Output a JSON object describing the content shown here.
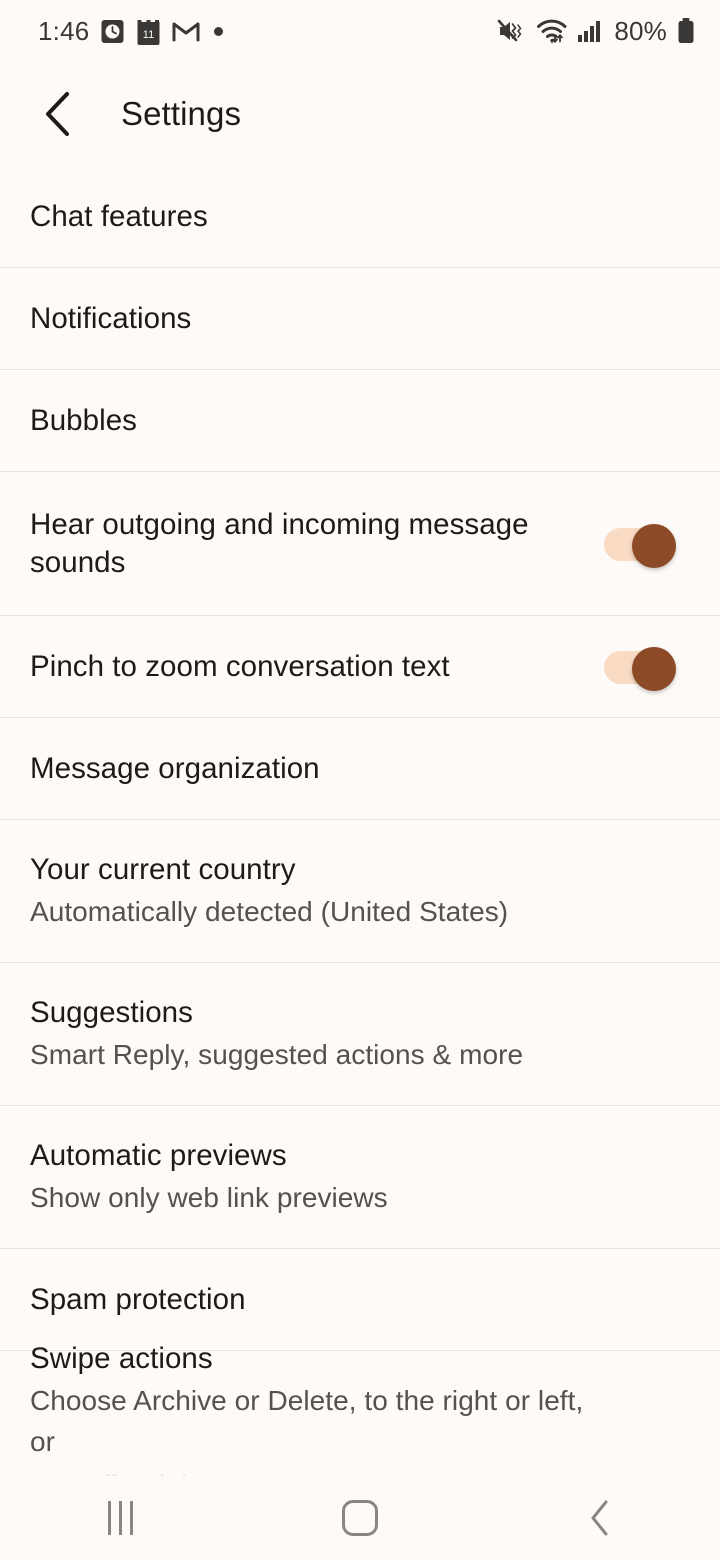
{
  "status_bar": {
    "time": "1:46",
    "battery_percent": "80%",
    "left_icons": [
      "alarm-clock-icon",
      "calendar-icon",
      "gmail-icon",
      "notification-dot-icon"
    ],
    "calendar_day": "11",
    "right_icons": [
      "mute-vibrate-icon",
      "wifi-icon",
      "cellular-signal-icon",
      "battery-icon"
    ]
  },
  "header": {
    "back_icon": "chevron-left-icon",
    "title": "Settings"
  },
  "settings": {
    "rows": [
      {
        "title": "Chat features",
        "subtitle": "",
        "toggle": null,
        "type": "single"
      },
      {
        "title": "Notifications",
        "subtitle": "",
        "toggle": null,
        "type": "single"
      },
      {
        "title": "Bubbles",
        "subtitle": "",
        "toggle": null,
        "type": "single"
      },
      {
        "title": "Hear outgoing and incoming message sounds",
        "subtitle": "",
        "toggle": "on",
        "type": "double"
      },
      {
        "title": "Pinch to zoom conversation text",
        "subtitle": "",
        "toggle": "on",
        "type": "single"
      },
      {
        "title": "Message organization",
        "subtitle": "",
        "toggle": null,
        "type": "single"
      },
      {
        "title": "Your current country",
        "subtitle": "Automatically detected (United States)",
        "toggle": null,
        "type": "sub"
      },
      {
        "title": "Suggestions",
        "subtitle": "Smart Reply, suggested actions & more",
        "toggle": null,
        "type": "sub"
      },
      {
        "title": "Automatic previews",
        "subtitle": "Show only web link previews",
        "toggle": null,
        "type": "sub"
      },
      {
        "title": "Spam protection",
        "subtitle": "",
        "toggle": null,
        "type": "single"
      },
      {
        "title": "Swipe actions",
        "subtitle": "Choose Archive or Delete, to the right or left, or",
        "subtitle2": "turn off swiping",
        "toggle": null,
        "type": "last"
      }
    ]
  },
  "nav_bar": {
    "recents_label": "recents-icon",
    "home_label": "home-icon",
    "back_label": "back-icon"
  },
  "colors": {
    "background": "#FDFAF8",
    "separator": "#E9E3DF",
    "title_text": "#1C1B1A",
    "subtitle_text": "#57514D",
    "toggle_thumb": "#8C4A26",
    "toggle_track": "#F9DBC4",
    "nav_icon": "#8A8482"
  }
}
